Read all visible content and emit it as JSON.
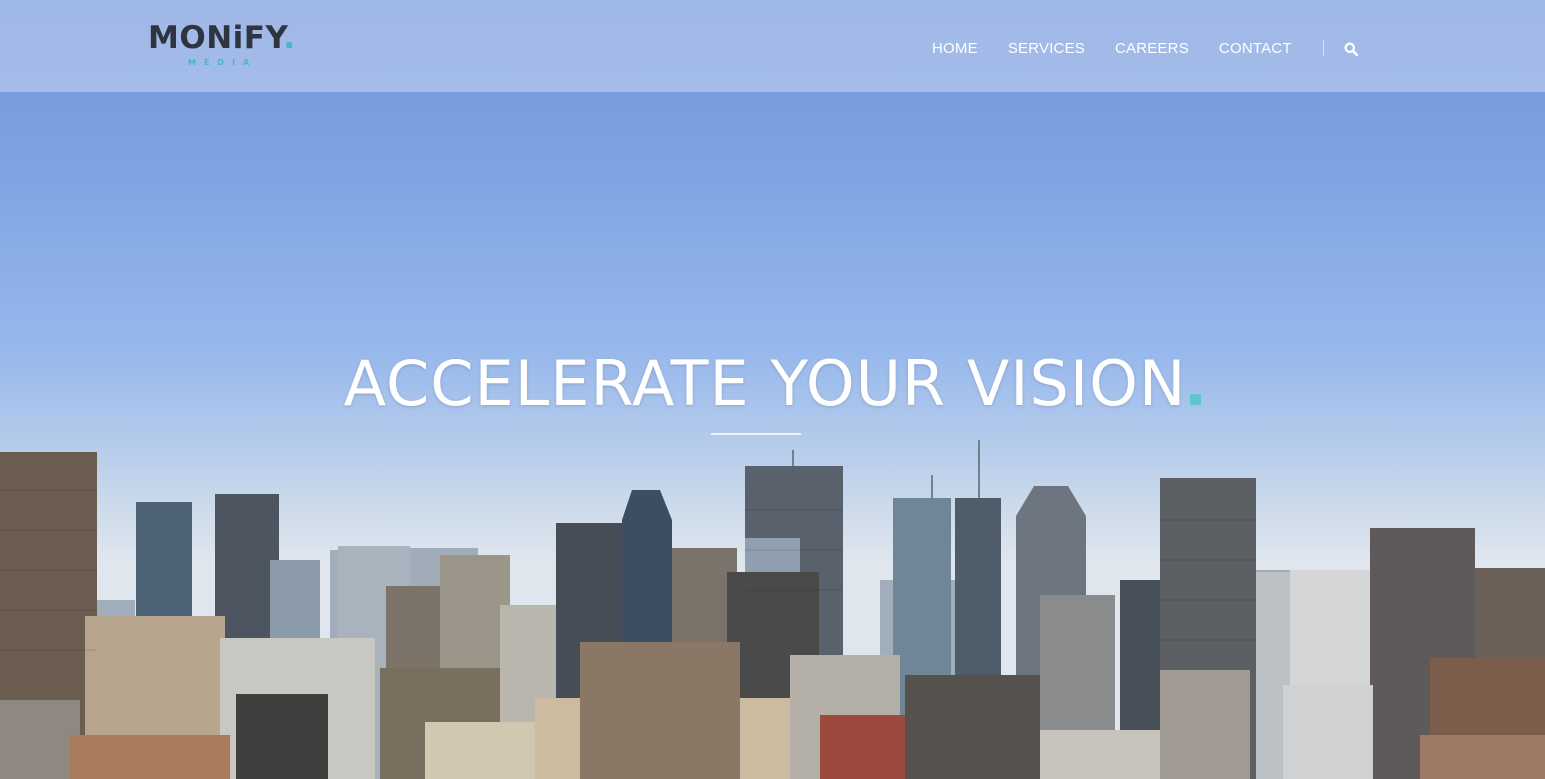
{
  "brand": {
    "name_main": "MONiFY",
    "name_dot": ".",
    "name_sub": "MEDIA",
    "accent_color": "#3fbdbd",
    "text_color": "#2f3441"
  },
  "nav": {
    "items": [
      {
        "label": "HOME"
      },
      {
        "label": "SERVICES"
      },
      {
        "label": "CAREERS"
      },
      {
        "label": "CONTACT"
      }
    ],
    "search_icon": "search-icon"
  },
  "hero": {
    "headline": "ACCELERATE YOUR VISION",
    "headline_dot_color": "#5fc7c9",
    "background_image": "city-skyline-photo"
  }
}
